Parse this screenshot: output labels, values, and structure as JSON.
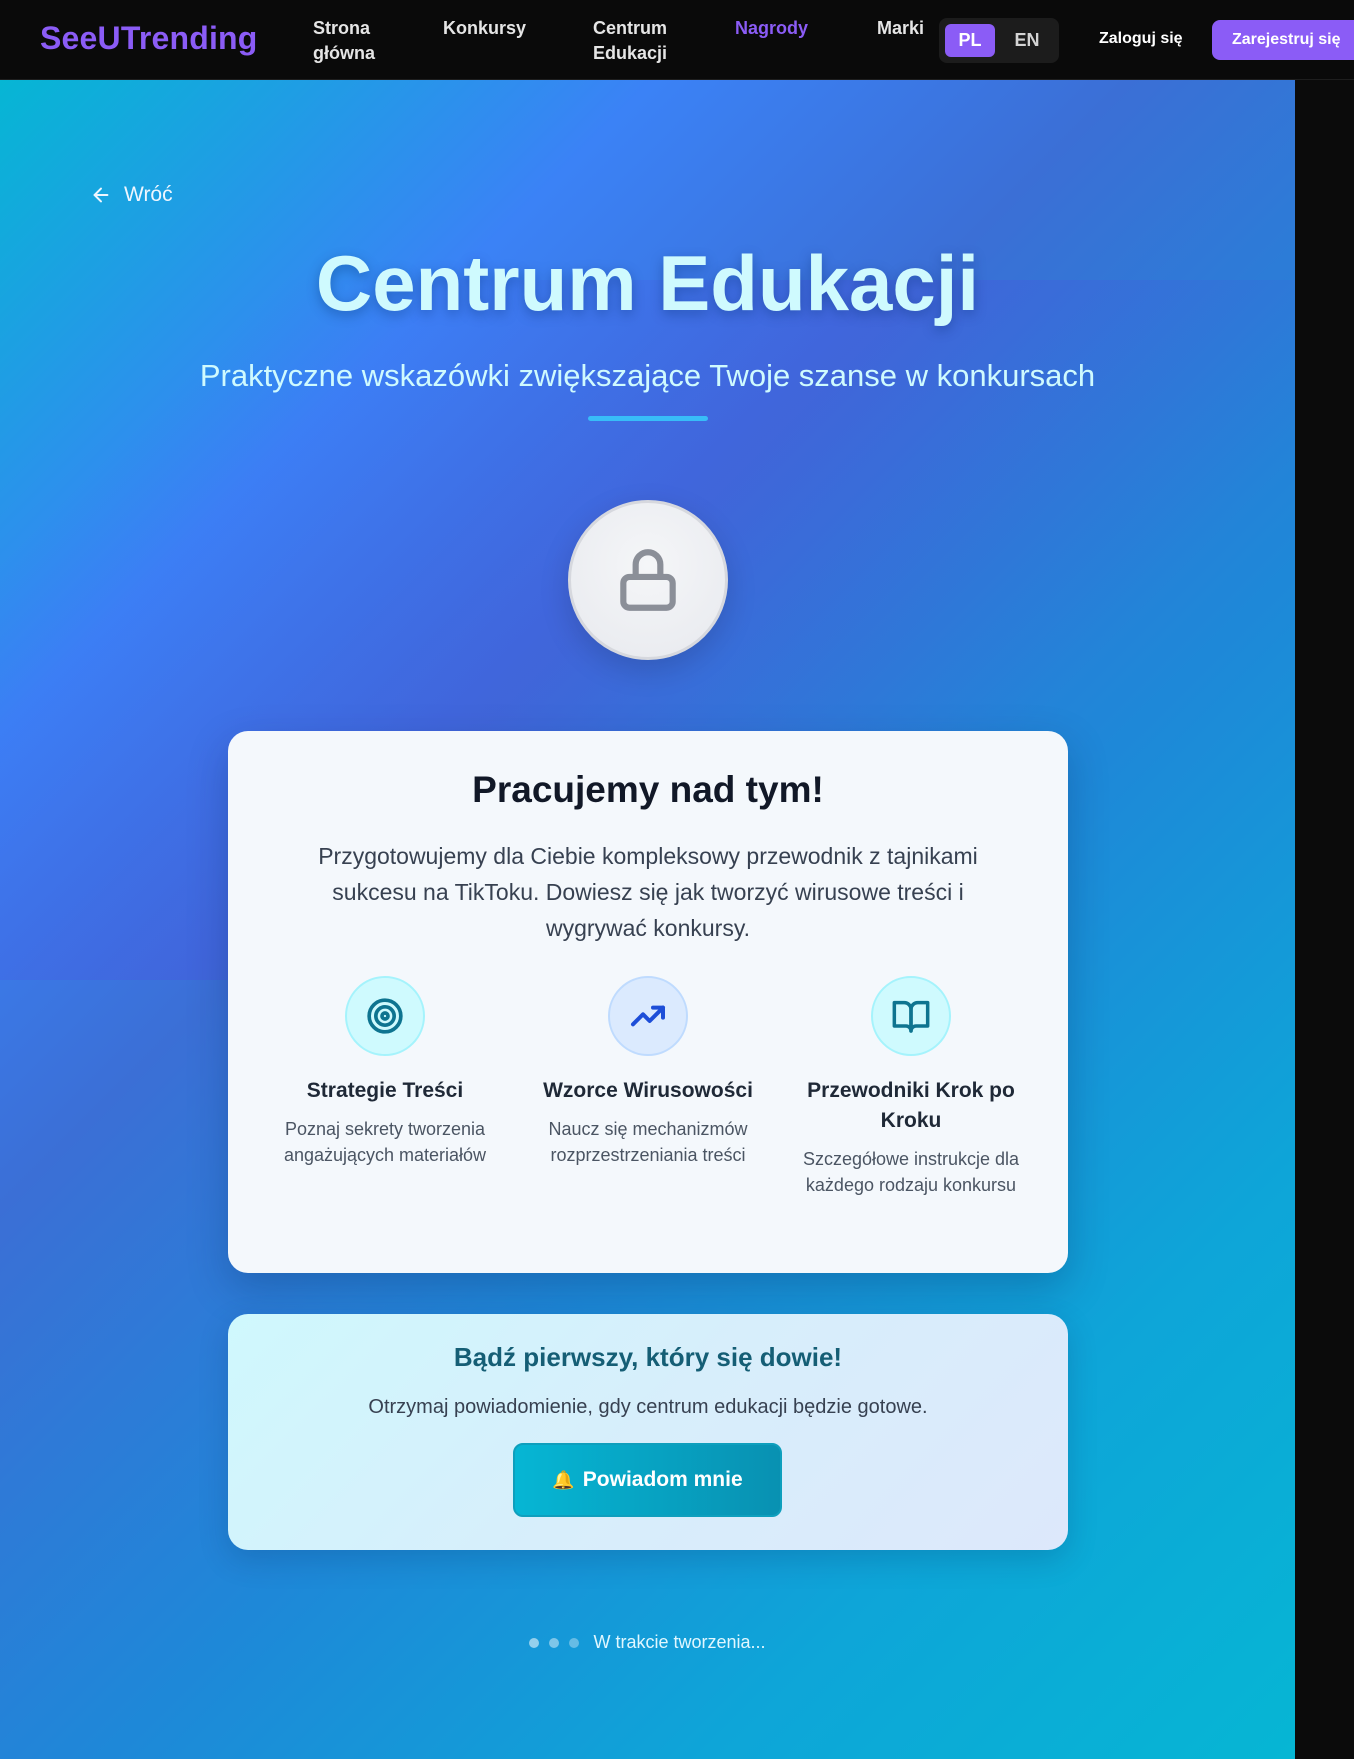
{
  "brand": {
    "logo_text": "SeeUTrending",
    "accent_color": "#8b5cf6"
  },
  "nav": {
    "links": [
      {
        "label": "Strona\nglówna",
        "line1": "Strona",
        "line2": "główna"
      },
      {
        "label": "Konkursy"
      },
      {
        "line1": "Centrum",
        "line2": "Edukacji"
      },
      {
        "label": "Nagrody",
        "active": true
      },
      {
        "label": "Marki"
      }
    ],
    "languages": [
      {
        "label": "PL",
        "selected": true
      },
      {
        "label": "EN",
        "selected": false
      }
    ],
    "login_label": "Zaloguj się",
    "register_label": "Zarejestruj się"
  },
  "hero": {
    "back_label": "Wróć",
    "title": "Centrum Edukacji",
    "subtitle": "Praktyczne wskazówki zwiększające Twoje szanse w konkursach",
    "status_icon": "lock-icon"
  },
  "card": {
    "title": "Pracujemy nad tym!",
    "description": "Przygotowujemy dla Ciebie kompleksowy przewodnik z tajnikami sukcesu na TikToku. Dowiesz się jak tworzyć wirusowe treści i wygrywać konkursy.",
    "features": [
      {
        "icon": "target-icon",
        "title": "Strategie Treści",
        "text": "Poznaj sekrety tworzenia angażujących materiałów"
      },
      {
        "icon": "trending-up-icon",
        "title": "Wzorce Wirusowości",
        "text": "Naucz się mechanizmów rozprzestrzeniania treści"
      },
      {
        "icon": "book-open-icon",
        "title": "Przewodniki Krok po Kroku",
        "text": "Szczegółowe instrukcje dla każdego rodzaju konkursu"
      }
    ]
  },
  "notify": {
    "title": "Bądź pierwszy, który się dowie!",
    "text": "Otrzymaj powiadomienie, gdy centrum edukacji będzie gotowe.",
    "button_icon": "bell-icon",
    "button_label": "Powiadom mnie"
  },
  "status": {
    "text": "W trakcie tworzenia..."
  }
}
